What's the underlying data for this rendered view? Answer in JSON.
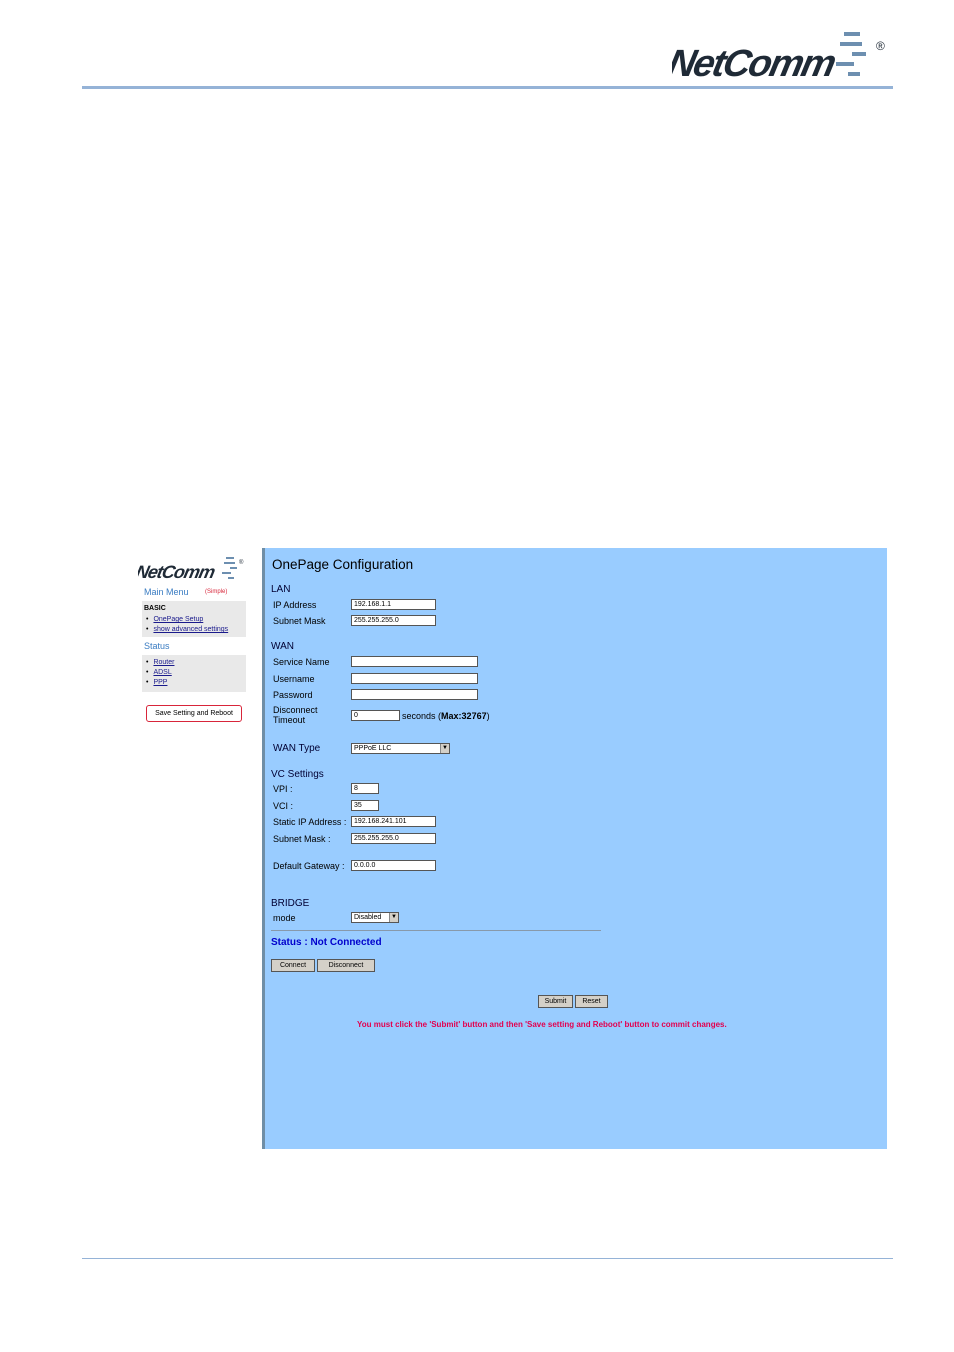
{
  "brand": {
    "name": "NetComm",
    "reg": "®"
  },
  "sidebar": {
    "main_menu": "Main Menu",
    "mode_tag": "(Simple)",
    "basic_heading": "BASIC",
    "basic_items": [
      {
        "label": "OnePage Setup"
      },
      {
        "label": "show advanced settings"
      }
    ],
    "status_heading": "Status",
    "status_items": [
      {
        "label": "Router"
      },
      {
        "label": "ADSL"
      },
      {
        "label": "PPP"
      }
    ],
    "save_reboot": "Save Setting and Reboot"
  },
  "main": {
    "title": "OnePage Configuration",
    "lan": {
      "heading": "LAN",
      "ip_label": "IP Address",
      "ip_value": "192.168.1.1",
      "mask_label": "Subnet Mask",
      "mask_value": "255.255.255.0"
    },
    "wan": {
      "heading": "WAN",
      "service_label": "Service Name",
      "service_value": "",
      "username_label": "Username",
      "username_value": "",
      "password_label": "Password",
      "password_value": "",
      "disconnect_label_1": "Disconnect",
      "disconnect_label_2": "Timeout",
      "disconnect_value": "0",
      "seconds_text": "seconds",
      "max_open": "(",
      "max_text": "Max:32767",
      "max_close": ")"
    },
    "wan_type": {
      "label": "WAN Type",
      "selected": "PPPoE LLC"
    },
    "vc": {
      "heading": "VC Settings",
      "vpi_label": "VPI :",
      "vpi_value": "8",
      "vci_label": "VCI :",
      "vci_value": "35",
      "static_ip_label": "Static IP Address :",
      "static_ip_value": "192.168.241.101",
      "mask_label": "Subnet Mask :",
      "mask_value": "255.255.255.0",
      "gateway_label": "Default Gateway :",
      "gateway_value": "0.0.0.0"
    },
    "bridge": {
      "heading": "BRIDGE",
      "mode_label": "mode",
      "mode_selected": "Disabled"
    },
    "status_text": "Status : Not Connected",
    "connect": "Connect",
    "disconnect": "Disconnect",
    "submit": "Submit",
    "reset": "Reset",
    "warning": "You must click the 'Submit' button and then 'Save setting and Reboot' button to commit changes."
  },
  "colors": {
    "panel": "#99ccff",
    "accent": "#3a7cc2",
    "warning": "#e3004f",
    "status": "#0000cc"
  }
}
